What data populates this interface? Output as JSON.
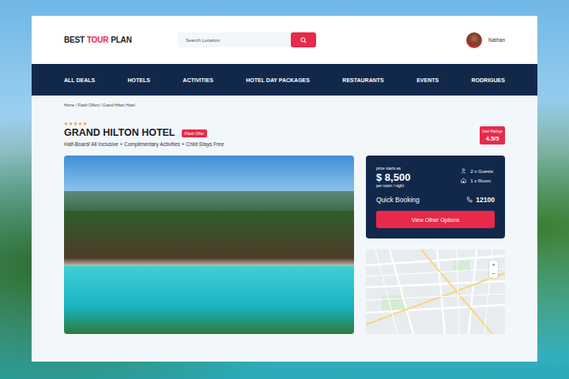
{
  "logo": {
    "first": "BEST",
    "accent": "TOUR",
    "last": "PLAN"
  },
  "search": {
    "placeholder": "Search Location"
  },
  "user": {
    "name": "Nathan"
  },
  "nav": [
    {
      "label": "ALL DEALS"
    },
    {
      "label": "HOTELS"
    },
    {
      "label": "ACTIVITIES"
    },
    {
      "label": "HOTEL DAY PACKAGES"
    },
    {
      "label": "RESTAURANTS"
    },
    {
      "label": "EVENTS"
    },
    {
      "label": "RODRIGUES"
    }
  ],
  "breadcrumb": "Home / Flash Offers / Grand Hilton Hotel",
  "hotel": {
    "stars": 5,
    "name": "GRAND HILTON HOTEL",
    "badge": "Flash Offer",
    "subtitle": "Half-Board/ All Inclusive + Complimentary Activities + Child Stays Free"
  },
  "rating": {
    "label": "User Ratings",
    "value": "4.5/5"
  },
  "booking": {
    "price_label": "price starts as",
    "price": "$ 8,500",
    "price_unit": "per room / night",
    "guests": "2 x Guests",
    "rooms": "1 x Room",
    "title": "Quick Booking",
    "phone": "12100",
    "button": "View Other Options"
  },
  "map": {
    "zoom_in": "+",
    "zoom_out": "−"
  }
}
